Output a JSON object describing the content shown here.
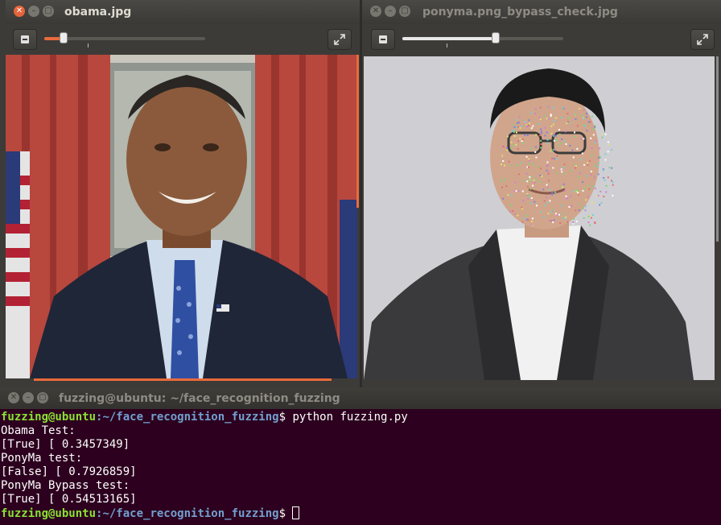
{
  "left_window": {
    "title": "obama.jpg",
    "slider_level": 0.12
  },
  "right_window": {
    "title": "ponyma.png_bypass_check.jpg",
    "slider_level": 0.58
  },
  "background_window": {
    "partial_letters": [
      "e",
      "s",
      "f",
      "r",
      "a",
      "a",
      "a",
      "a"
    ]
  },
  "terminal": {
    "title": "fuzzing@ubuntu: ~/face_recognition_fuzzing",
    "prompt_user": "fuzzing@ubuntu",
    "prompt_path": ":~/face_recognition_fuzzing",
    "prompt_symbol": "$",
    "command": " python fuzzing.py",
    "output": [
      "Obama Test:",
      "[True] [ 0.3457349]",
      "PonyMa test:",
      "[False] [ 0.7926859]",
      "PonyMa Bypass test:",
      "[True] [ 0.54513165]"
    ]
  },
  "icons": {
    "close": "close-icon",
    "minimize": "minimize-icon",
    "maximize": "maximize-icon",
    "zoom_out": "zoom-out-icon",
    "fullscreen": "fullscreen-icon"
  },
  "colors": {
    "terminal_bg": "#2c001e",
    "prompt_user": "#8ae234",
    "prompt_path": "#729fcf",
    "close_button": "#e7643b",
    "slider_active": "#e96b3b"
  }
}
